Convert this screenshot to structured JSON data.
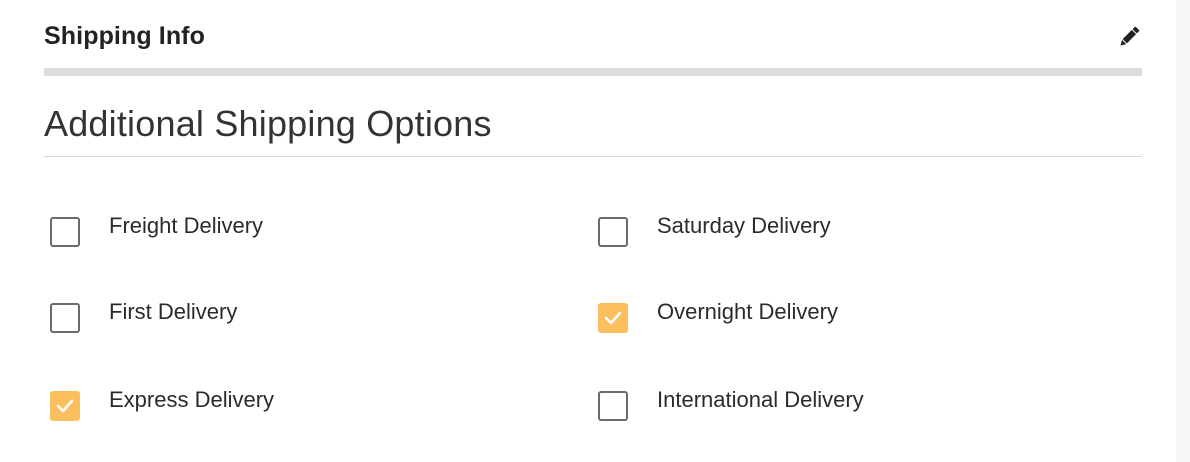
{
  "header": {
    "title": "Shipping Info",
    "edit_icon": "pencil-icon"
  },
  "section": {
    "title": "Additional Shipping Options"
  },
  "options": [
    {
      "label": "Freight Delivery",
      "checked": false
    },
    {
      "label": "Saturday Delivery",
      "checked": false
    },
    {
      "label": "First Delivery",
      "checked": false
    },
    {
      "label": "Overnight Delivery",
      "checked": true
    },
    {
      "label": "Express Delivery",
      "checked": true
    },
    {
      "label": "International Delivery",
      "checked": false
    }
  ],
  "colors": {
    "checked_fill": "#fbbf5d",
    "unchecked_border": "#6b6b6b",
    "header_bar": "#dcdcdc"
  }
}
